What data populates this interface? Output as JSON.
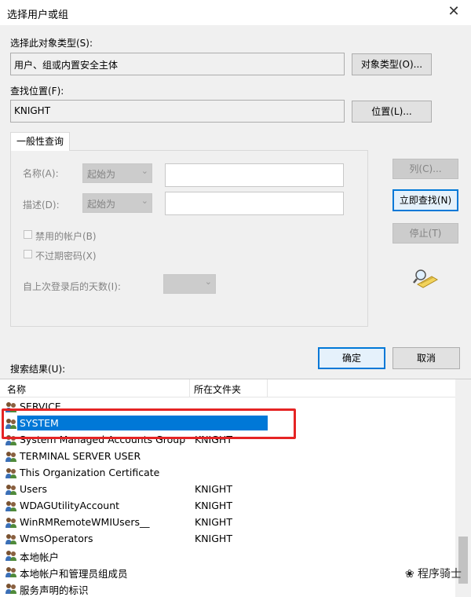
{
  "window": {
    "title": "选择用户或组",
    "close": "✕"
  },
  "object_types": {
    "label": "选择此对象类型(S):",
    "value": "用户、组或内置安全主体",
    "button": "对象类型(O)..."
  },
  "location": {
    "label": "查找位置(F):",
    "value": "KNIGHT",
    "button": "位置(L)..."
  },
  "query": {
    "tab": "一般性查询",
    "name_label": "名称(A):",
    "name_mode": "起始为",
    "desc_label": "描述(D):",
    "desc_mode": "起始为",
    "disabled_accounts": "禁用的帐户(B)",
    "no_expire": "不过期密码(X)",
    "days_label": "自上次登录后的天数(I):"
  },
  "side_buttons": {
    "columns": "列(C)...",
    "find_now": "立即查找(N)",
    "stop": "停止(T)"
  },
  "ok": "确定",
  "cancel": "取消",
  "results": {
    "label": "搜索结果(U):",
    "columns": [
      "名称",
      "所在文件夹"
    ],
    "rows": [
      {
        "name": "SERVICE",
        "folder": ""
      },
      {
        "name": "SYSTEM",
        "folder": "",
        "selected": true
      },
      {
        "name": "System Managed Accounts Group",
        "folder": "KNIGHT"
      },
      {
        "name": "TERMINAL SERVER USER",
        "folder": ""
      },
      {
        "name": "This Organization Certificate",
        "folder": ""
      },
      {
        "name": "Users",
        "folder": "KNIGHT"
      },
      {
        "name": "WDAGUtilityAccount",
        "folder": "KNIGHT"
      },
      {
        "name": "WinRMRemoteWMIUsers__",
        "folder": "KNIGHT"
      },
      {
        "name": "WmsOperators",
        "folder": "KNIGHT"
      },
      {
        "name": "本地帐户",
        "folder": ""
      },
      {
        "name": "本地帐户和管理员组成员",
        "folder": ""
      },
      {
        "name": "服务声明的标识",
        "folder": ""
      }
    ]
  },
  "watermark": "程序骑士",
  "colors": {
    "selection": "#0078d7",
    "highlight_box": "#e52424"
  }
}
